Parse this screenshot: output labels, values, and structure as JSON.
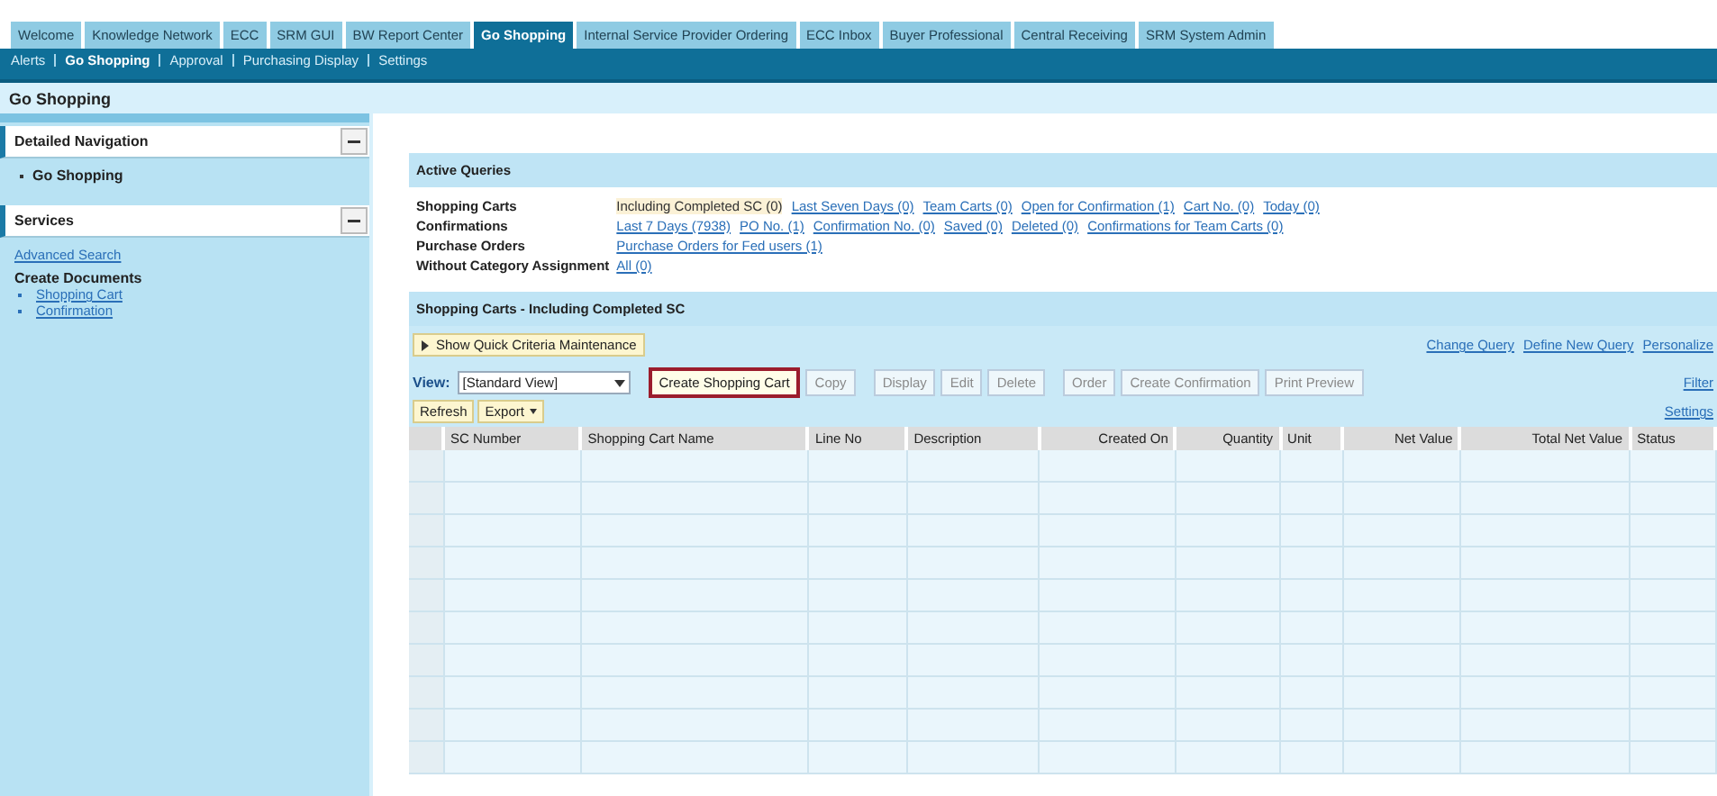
{
  "top_tabs": [
    {
      "label": "Welcome",
      "selected": false
    },
    {
      "label": "Knowledge Network",
      "selected": false
    },
    {
      "label": "ECC",
      "selected": false
    },
    {
      "label": "SRM GUI",
      "selected": false
    },
    {
      "label": "BW Report Center",
      "selected": false
    },
    {
      "label": "Go Shopping",
      "selected": true
    },
    {
      "label": "Internal Service Provider Ordering",
      "selected": false
    },
    {
      "label": "ECC Inbox",
      "selected": false
    },
    {
      "label": "Buyer Professional",
      "selected": false
    },
    {
      "label": "Central Receiving",
      "selected": false
    },
    {
      "label": "SRM System Admin",
      "selected": false
    }
  ],
  "sub_tabs": [
    {
      "label": "Alerts",
      "selected": false
    },
    {
      "label": "Go Shopping",
      "selected": true
    },
    {
      "label": "Approval",
      "selected": false
    },
    {
      "label": "Purchasing Display",
      "selected": false
    },
    {
      "label": "Settings",
      "selected": false
    }
  ],
  "page_title": "Go Shopping",
  "sidebar": [
    {
      "title": "Detailed Navigation",
      "expanded": true,
      "items": [
        {
          "kind": "nav",
          "label": "Go Shopping"
        }
      ]
    },
    {
      "title": "Services",
      "expanded": true,
      "items": [
        {
          "kind": "link",
          "label": "Advanced Search"
        },
        {
          "kind": "heading",
          "label": "Create Documents"
        },
        {
          "kind": "bullet",
          "label": "Shopping Cart"
        },
        {
          "kind": "bullet",
          "label": "Confirmation"
        }
      ]
    }
  ],
  "active_queries": {
    "title": "Active Queries",
    "rows": [
      {
        "label": "Shopping Carts",
        "links": [
          {
            "label": "Including Completed SC (0)",
            "selected": true
          },
          {
            "label": "Last Seven Days (0)",
            "selected": false
          },
          {
            "label": "Team Carts (0)",
            "selected": false
          },
          {
            "label": "Open for Confirmation (1)",
            "selected": false
          },
          {
            "label": "Cart No. (0)",
            "selected": false
          },
          {
            "label": "Today (0)",
            "selected": false
          }
        ]
      },
      {
        "label": "Confirmations",
        "links": [
          {
            "label": "Last 7 Days (7938)",
            "selected": false
          },
          {
            "label": "PO No. (1)",
            "selected": false
          },
          {
            "label": "Confirmation No. (0)",
            "selected": false
          },
          {
            "label": "Saved (0)",
            "selected": false
          },
          {
            "label": "Deleted (0)",
            "selected": false
          },
          {
            "label": "Confirmations for Team Carts (0)",
            "selected": false
          }
        ]
      },
      {
        "label": "Purchase Orders",
        "links": [
          {
            "label": "Purchase Orders for Fed users (1)",
            "selected": false
          }
        ]
      },
      {
        "label": "Without Category Assignment",
        "links": [
          {
            "label": "All (0)",
            "selected": false
          }
        ]
      }
    ]
  },
  "results": {
    "title": "Shopping Carts - Including Completed SC",
    "criteria_button": "Show Quick Criteria Maintenance",
    "query_links": [
      "Change Query",
      "Define New Query",
      "Personalize"
    ],
    "view_label": "View:",
    "view_value": "[Standard View]",
    "action_groups": [
      [
        {
          "label": "Create Shopping Cart",
          "disabled": false,
          "highlighted": true
        },
        {
          "label": "Copy",
          "disabled": true,
          "highlighted": false
        }
      ],
      [
        {
          "label": "Display",
          "disabled": true,
          "highlighted": false
        },
        {
          "label": "Edit",
          "disabled": true,
          "highlighted": false
        },
        {
          "label": "Delete",
          "disabled": true,
          "highlighted": false
        }
      ],
      [
        {
          "label": "Order",
          "disabled": true,
          "highlighted": false
        },
        {
          "label": "Create Confirmation",
          "disabled": true,
          "highlighted": false
        },
        {
          "label": "Print Preview",
          "disabled": true,
          "highlighted": false
        }
      ]
    ],
    "right_links": [
      "Filter",
      "Settings"
    ],
    "buttons": [
      "Refresh",
      "Export"
    ],
    "columns": [
      "SC Number",
      "Shopping Cart Name",
      "Line No",
      "Description",
      "Created On",
      "Quantity",
      "Unit",
      "Net Value",
      "Total Net Value",
      "Status"
    ]
  }
}
